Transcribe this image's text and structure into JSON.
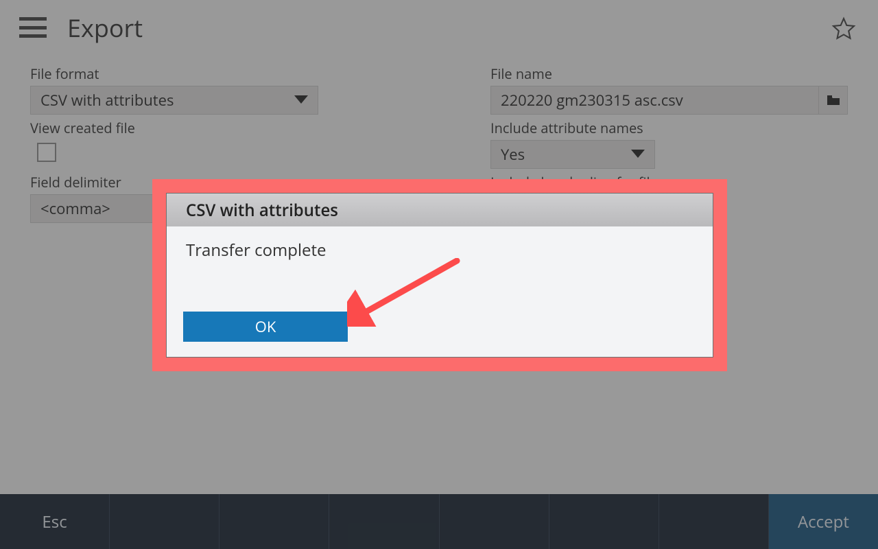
{
  "header": {
    "title": "Export"
  },
  "form": {
    "file_format": {
      "label": "File format",
      "value": "CSV with attributes"
    },
    "file_name": {
      "label": "File name",
      "value": "220220 gm230315 asc.csv"
    },
    "view_created": {
      "label": "View created file",
      "checked": false
    },
    "include_attr": {
      "label": "Include attribute names",
      "value": "Yes"
    },
    "field_delim": {
      "label": "Field delimiter",
      "value": "<comma>"
    },
    "include_header": {
      "label": "Include header line for file"
    }
  },
  "modal": {
    "title": "CSV with attributes",
    "message": "Transfer complete",
    "ok": "OK"
  },
  "footer": {
    "esc": "Esc",
    "accept": "Accept"
  }
}
